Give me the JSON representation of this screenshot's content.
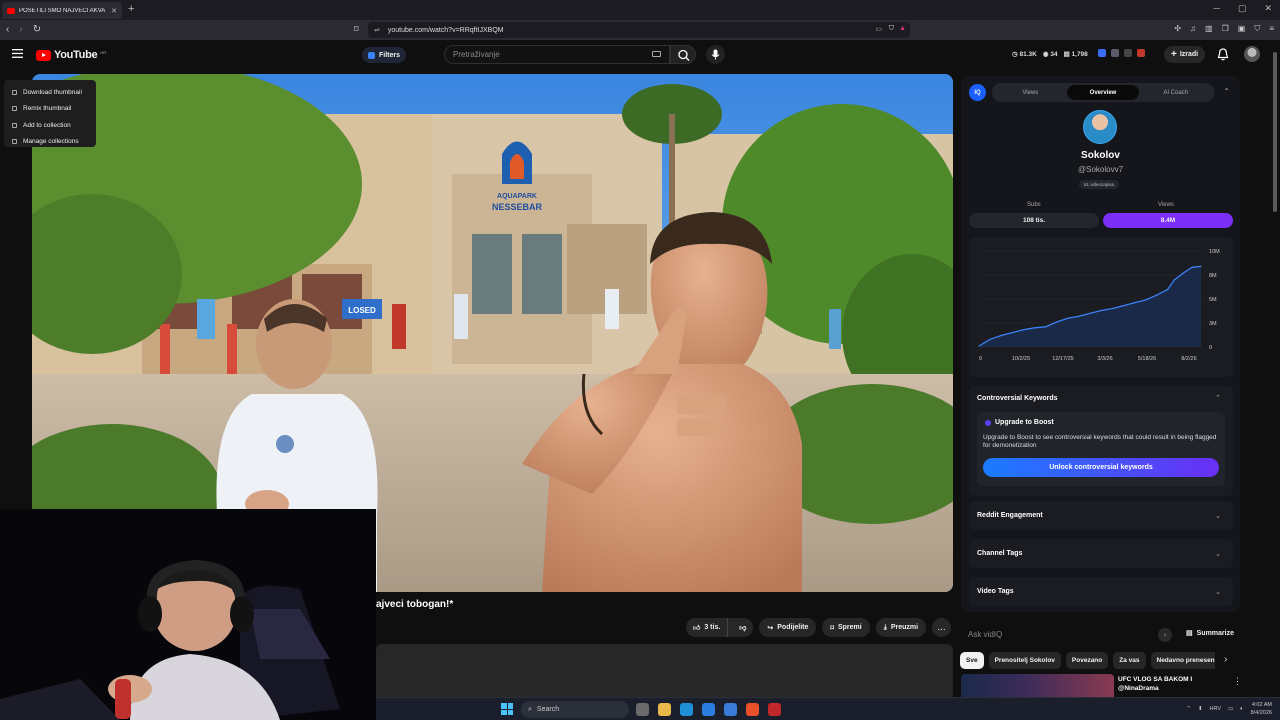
{
  "browser": {
    "tab_title": "POSETILI SMO NAJVECI AKVA P...",
    "new_tab": "+",
    "url": "youtube.com/watch?v=RRqftIJXBQM"
  },
  "youtube": {
    "logo_text": "YouTube",
    "country_code": "HR",
    "filters_label": "Filters",
    "search_placeholder": "Pretraživanje",
    "stats": {
      "views": "81.3K",
      "eye": "34",
      "count": "1,798"
    },
    "create_label": "Izradi"
  },
  "context_menu": {
    "items": [
      {
        "label": "Download thumbnail"
      },
      {
        "label": "Remix thumbnail"
      },
      {
        "label": "Add to collection"
      },
      {
        "label": "Manage collections"
      }
    ]
  },
  "video": {
    "title_fragment": "ajveci tobogan!*",
    "sign_line1": "AQUAPARK",
    "sign_line2": "NESSEBAR",
    "booth_sign_left": "ED",
    "booth_sign_right": "LOSED"
  },
  "actions": {
    "like_count": "3 tis.",
    "share": "Podijelite",
    "save": "Spremi",
    "download": "Preuzmi",
    "more": "..."
  },
  "vidiq": {
    "logo": "IQ",
    "tabs": [
      {
        "label": "Views",
        "active": false
      },
      {
        "label": "Overview",
        "active": true
      },
      {
        "label": "AI Coach",
        "active": false
      }
    ],
    "channel_name": "Sokolov",
    "channel_handle": "@Sokolovv7",
    "videos_count": "61 videozapisa",
    "subs_label": "Subs",
    "views_label": "Views",
    "subs_value": "108 tis.",
    "views_value": "8.4M",
    "keywords_title": "Controversial Keywords",
    "boost_title": "Upgrade to Boost",
    "boost_text": "Upgrade to Boost to see controversial keywords that could result in being flagged for demonetization",
    "unlock_label": "Unlock controversial keywords",
    "reddit": "Reddit Engagement",
    "channel_tags": "Channel Tags",
    "video_tags": "Video Tags",
    "ask_placeholder": "Ask vidIQ",
    "summarize": "Summarize"
  },
  "chart_data": {
    "type": "line",
    "x_ticks": [
      "0",
      "10/2/25",
      "12/17/25",
      "3/3/26",
      "5/18/26",
      "8/2/26"
    ],
    "y_ticks": [
      "0",
      "3M",
      "5M",
      "8M",
      "10M"
    ],
    "ylim": [
      0,
      10
    ],
    "y_unit": "M",
    "x": [
      0,
      0.05,
      0.1,
      0.15,
      0.2,
      0.25,
      0.3,
      0.35,
      0.4,
      0.45,
      0.5,
      0.55,
      0.6,
      0.65,
      0.7,
      0.75,
      0.8,
      0.85,
      0.88,
      0.92,
      0.96,
      1.0
    ],
    "values": [
      0.1,
      0.8,
      1.2,
      1.5,
      1.8,
      2.0,
      2.1,
      2.6,
      3.0,
      3.2,
      3.5,
      3.8,
      4.0,
      4.3,
      4.6,
      4.9,
      5.4,
      6.0,
      7.0,
      7.7,
      8.3,
      8.4
    ],
    "grid": true,
    "color": "#3b82f6"
  },
  "chips": [
    {
      "label": "Sve",
      "active": true
    },
    {
      "label": "Prenositelj Sokolov",
      "active": false
    },
    {
      "label": "Povezano",
      "active": false
    },
    {
      "label": "Za vas",
      "active": false
    },
    {
      "label": "Nedavno prenesen",
      "active": false
    }
  ],
  "recommendation": {
    "title": "UFC VLOG SA BAKOM I",
    "channel": "@NinaDrama"
  },
  "taskbar": {
    "search": "Search",
    "lang": "HRV",
    "time": "4:02 AM",
    "date": "8/4/2026"
  }
}
